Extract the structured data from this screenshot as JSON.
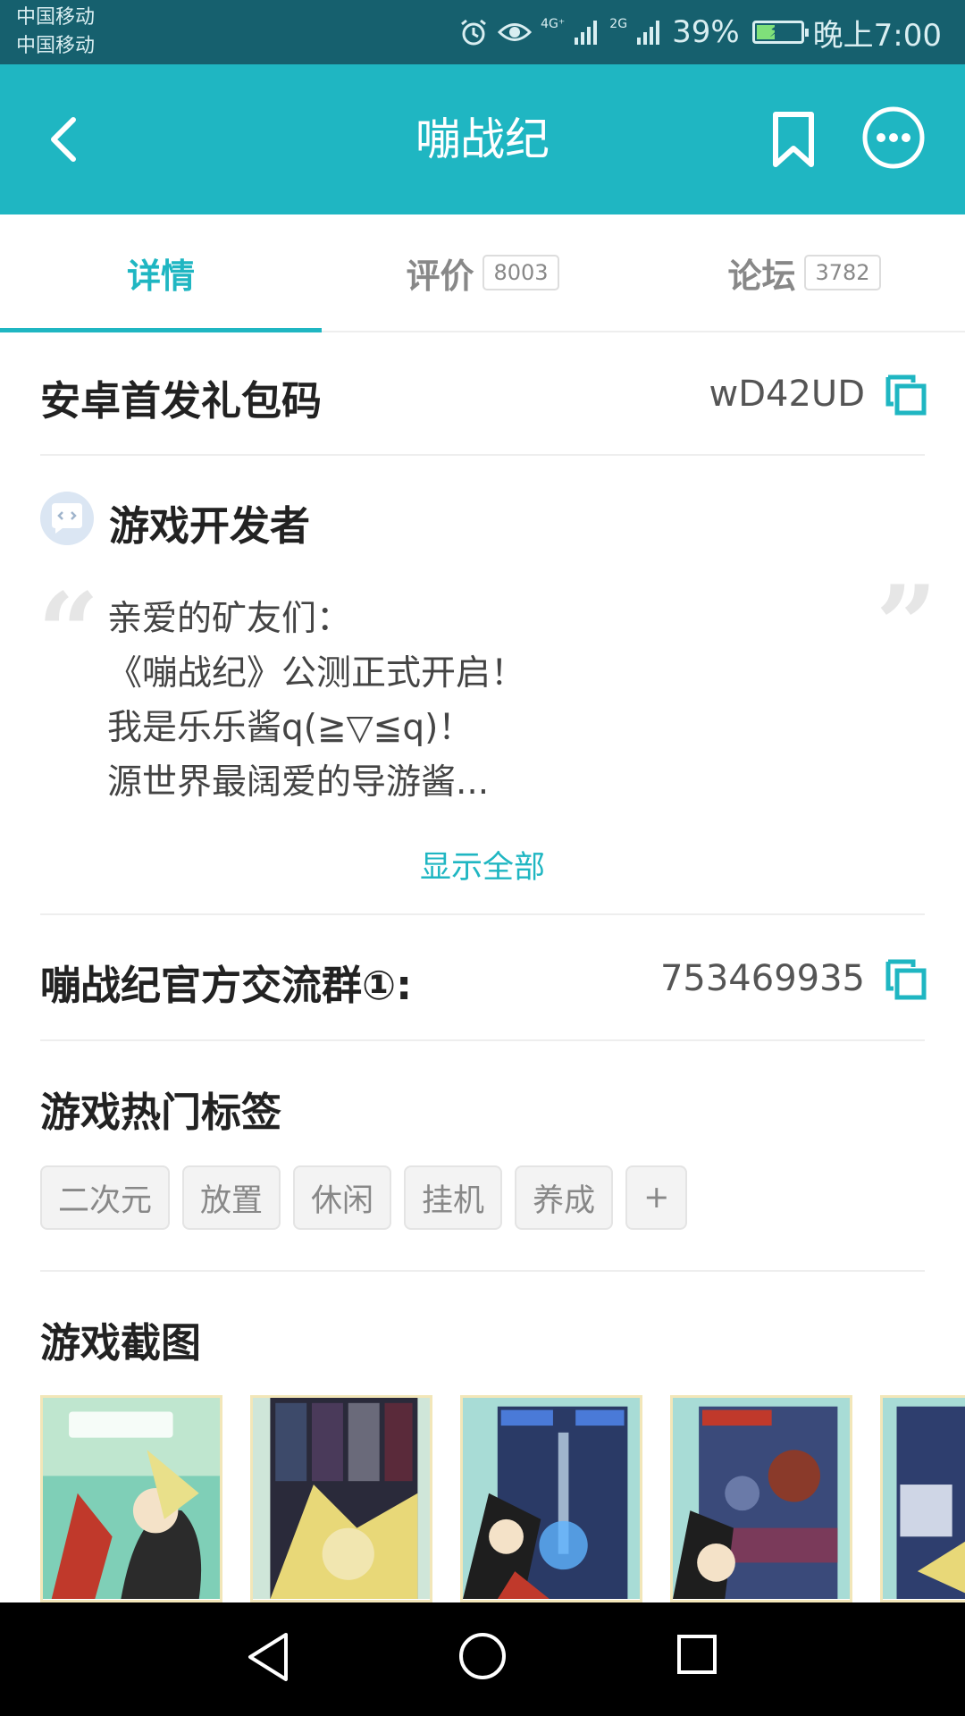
{
  "status_bar": {
    "carrier_1": "中国移动",
    "carrier_2": "中国移动",
    "network_1": "4G⁺",
    "network_2": "2G",
    "battery": "39%",
    "time": "晚上7:00"
  },
  "app_bar": {
    "title": "嘣战纪",
    "icons": [
      "back-icon",
      "bookmark-icon",
      "more-icon"
    ]
  },
  "tabs": [
    {
      "label": "详情",
      "count": "",
      "active": true
    },
    {
      "label": "评价",
      "count": "8003",
      "active": false
    },
    {
      "label": "论坛",
      "count": "3782",
      "active": false
    }
  ],
  "gift_code": {
    "title": "安卓首发礼包码",
    "code": "wD42UD",
    "icon": "copy-icon"
  },
  "developer": {
    "title": "游戏开发者",
    "lines": [
      "亲爱的矿友们：",
      "《嘣战纪》公测正式开启！",
      "我是乐乐酱q(≧▽≦q)！",
      "源世界最阔爱的导游酱..."
    ],
    "show_all": "显示全部"
  },
  "group": {
    "title": "嘣战纪官方交流群①:",
    "number": "753469935",
    "icon": "copy-icon"
  },
  "hot_tags": {
    "title": "游戏热门标签",
    "tags": [
      "二次元",
      "放置",
      "休闲",
      "挂机",
      "养成",
      "+"
    ]
  },
  "screenshots": {
    "title": "游戏截图",
    "count": 5
  },
  "colors": {
    "accent": "#1fb6c2",
    "status_bar": "#16606e"
  }
}
